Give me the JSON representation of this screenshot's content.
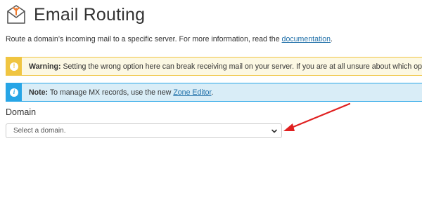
{
  "header": {
    "title": "Email Routing",
    "icon": "email-routing-icon",
    "accent_color": "#f07b2e"
  },
  "intro": {
    "text": "Route a domain’s incoming mail to a specific server. For more information, read the ",
    "link_text": "documentation",
    "suffix": "."
  },
  "warning": {
    "icon": "exclamation-icon",
    "label": "Warning:",
    "text": " Setting the wrong option here can break receiving mail on your server. If you are at all unsure about which option to select, cont",
    "color": "#f0c541"
  },
  "note": {
    "icon": "info-icon",
    "label": "Note:",
    "text": " To manage MX records, use the new ",
    "link_text": "Zone Editor",
    "suffix": ".",
    "color": "#27a5e6"
  },
  "domain": {
    "label": "Domain",
    "select_value": "Select a domain."
  },
  "annotation": {
    "arrow_color": "#e02020"
  }
}
